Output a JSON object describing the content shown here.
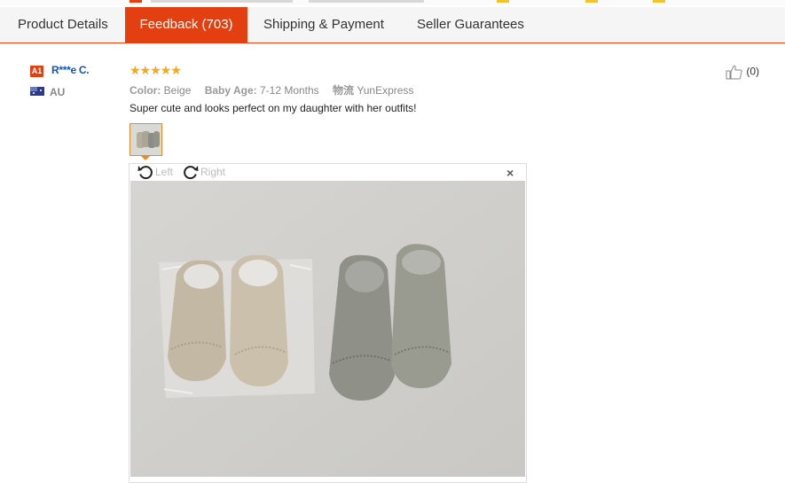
{
  "tabs": [
    {
      "label": "Product Details"
    },
    {
      "label": "Feedback (703)"
    },
    {
      "label": "Shipping & Payment"
    },
    {
      "label": "Seller Guarantees"
    }
  ],
  "reviewer": {
    "level_badge": "A1",
    "name": "R***e C.",
    "country": "AU"
  },
  "review": {
    "stars": "★★★★★",
    "attributes": [
      {
        "key": "Color:",
        "value": "Beige"
      },
      {
        "key": "Baby Age:",
        "value": "7-12 Months"
      },
      {
        "key": "物流",
        "value": "YunExpress"
      }
    ],
    "text": "Super cute and looks perfect on my daughter with her outfits!",
    "helpful_count": "(0)"
  },
  "viewer": {
    "rotate_left": "Left",
    "rotate_right": "Right",
    "close": "×"
  },
  "colors": {
    "accent": "#e33f11",
    "name_link": "#1156b8",
    "stars": "#f5a623"
  },
  "icons": [
    "thumbs-up-icon",
    "rotate-left-icon",
    "rotate-right-icon",
    "close-icon",
    "australia-flag-icon"
  ]
}
